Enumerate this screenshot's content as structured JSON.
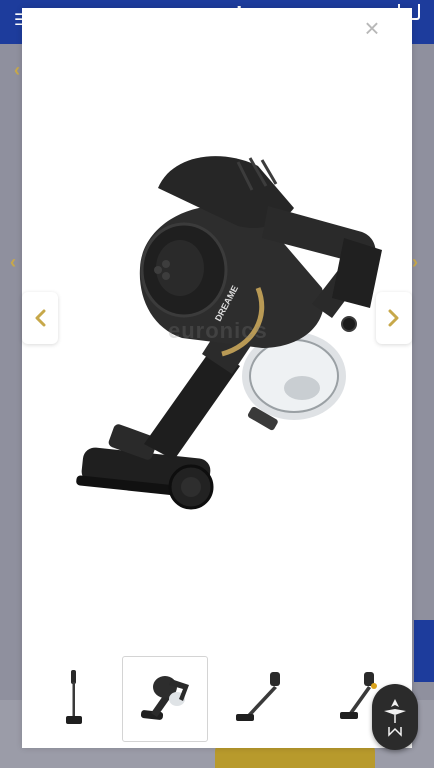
{
  "background": {
    "brand": "euronics",
    "menu_icon": "hamburger-icon",
    "cart_icon": "cart-icon"
  },
  "modal": {
    "close_label": "×",
    "close_icon": "close-icon",
    "prev_icon": "chevron-left-icon",
    "next_icon": "chevron-right-icon",
    "image_alt": "Dreame handheld vacuum cleaner",
    "product_brand_text": "DREAME",
    "watermark": "euronics"
  },
  "thumbnails": [
    {
      "name": "thumb-stick-vacuum-upright",
      "active": false
    },
    {
      "name": "thumb-handheld-vacuum",
      "active": true
    },
    {
      "name": "thumb-stick-vacuum-angled",
      "active": false
    },
    {
      "name": "thumb-stick-vacuum-floor",
      "active": false
    }
  ],
  "colors": {
    "accent": "#c7a84a",
    "header_blue": "#1d3c9c",
    "overlay": "#8f909e"
  },
  "fab": {
    "icon": "assistant-logo-icon"
  }
}
